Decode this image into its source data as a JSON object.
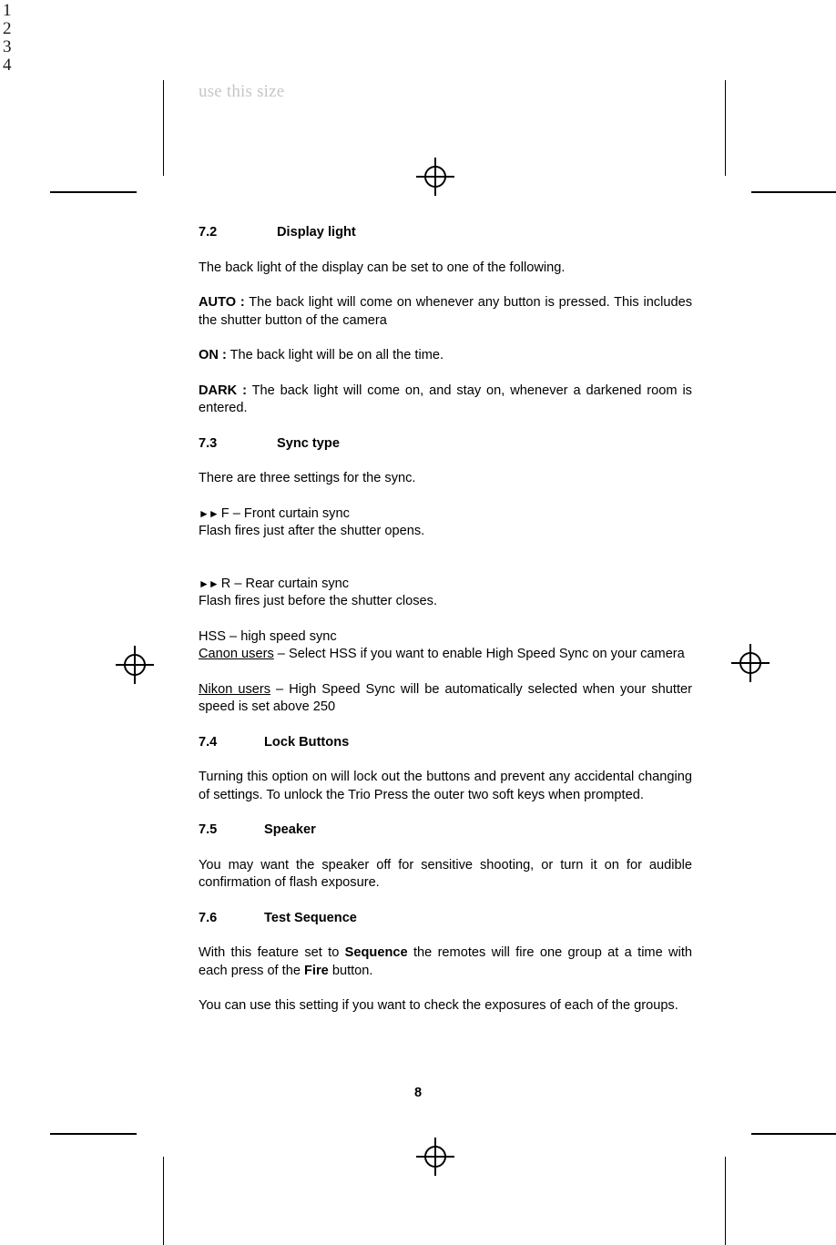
{
  "margin_numbers": [
    "1",
    "2",
    "3",
    "4"
  ],
  "guide_note": "use this size",
  "page_number": "8",
  "icons": {
    "registration_mark": "registration-target-icon",
    "sync_bullet": "double-right-triangle-icon"
  },
  "colors": {
    "text": "#000000",
    "guide_note": "#c6c6c6",
    "crop_marks": "#000000"
  },
  "sections": [
    {
      "number": "7.2",
      "title": "Display light",
      "paragraphs": [
        {
          "text": "The back light of the display can be set to one of the following."
        },
        {
          "lead": "AUTO :",
          "text": " The back light will come on whenever any button is pressed. This includes the shutter button of the camera"
        },
        {
          "lead": "ON :",
          "text": " The back light will be on all the time."
        },
        {
          "lead": "DARK :",
          "text": " The back light will come on, and stay on, whenever a darkened room is entered."
        }
      ]
    },
    {
      "number": "7.3",
      "title": "Sync type",
      "paragraphs": [
        {
          "text": "There are three settings for the sync."
        },
        {
          "bullet": true,
          "text": "F – Front curtain sync"
        },
        {
          "text": "Flash fires just after the shutter opens."
        },
        {
          "bullet": true,
          "text": "R – Rear curtain sync"
        },
        {
          "text": "Flash fires just before the shutter closes."
        },
        {
          "text": "HSS – high speed sync"
        },
        {
          "underlined": "Canon users",
          "text": " – Select HSS if you want to enable High Speed Sync on your camera"
        },
        {
          "underlined": "Nikon users",
          "text": " – High Speed Sync will be automatically selected when your shutter speed is set above 250"
        }
      ]
    },
    {
      "number": "7.4",
      "title": "Lock Buttons",
      "paragraphs": [
        {
          "text": "Turning this option on will lock out the buttons and prevent any accidental changing of settings.  To unlock the Trio Press the outer two soft keys when prompted."
        }
      ]
    },
    {
      "number": "7.5",
      "title": "Speaker",
      "paragraphs": [
        {
          "text": "You may want the speaker off for sensitive shooting, or turn it on for audible confirmation of flash exposure."
        }
      ]
    },
    {
      "number": "7.6",
      "title": "Test Sequence",
      "paragraphs": [
        {
          "pre": "With this feature set to ",
          "bold1": "Sequence",
          "mid": " the remotes will fire one group at a time with each press of the ",
          "bold2": "Fire",
          "post": " button."
        },
        {
          "text": "You can use this setting if you want to check the exposures of each of the groups."
        }
      ]
    }
  ]
}
